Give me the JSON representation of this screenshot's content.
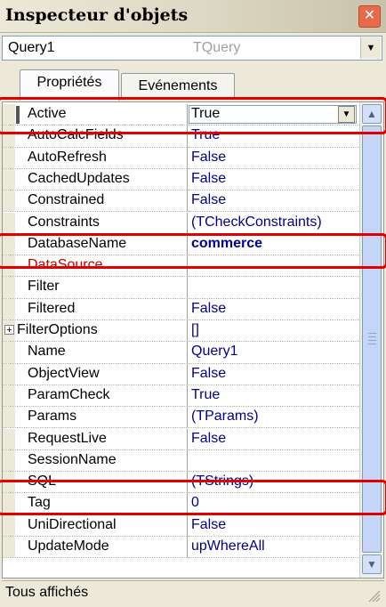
{
  "window": {
    "title": "Inspecteur d'objets"
  },
  "object_selector": {
    "name": "Query1",
    "type": "TQuery"
  },
  "tabs": [
    {
      "label": "Propriétés",
      "active": true
    },
    {
      "label": "Evénements",
      "active": false
    }
  ],
  "properties": [
    {
      "name": "Active",
      "value": "True",
      "selected": true
    },
    {
      "name": "AutoCalcFields",
      "value": "True"
    },
    {
      "name": "AutoRefresh",
      "value": "False"
    },
    {
      "name": "CachedUpdates",
      "value": "False"
    },
    {
      "name": "Constrained",
      "value": "False"
    },
    {
      "name": "Constraints",
      "value": "(TCheckConstraints)"
    },
    {
      "name": "DatabaseName",
      "value": "commerce",
      "bold": true
    },
    {
      "name": "DataSource",
      "value": "",
      "red": true
    },
    {
      "name": "Filter",
      "value": ""
    },
    {
      "name": "Filtered",
      "value": "False"
    },
    {
      "name": "FilterOptions",
      "value": "[]",
      "expandable": true
    },
    {
      "name": "Name",
      "value": "Query1"
    },
    {
      "name": "ObjectView",
      "value": "False"
    },
    {
      "name": "ParamCheck",
      "value": "True"
    },
    {
      "name": "Params",
      "value": "(TParams)"
    },
    {
      "name": "RequestLive",
      "value": "False"
    },
    {
      "name": "SessionName",
      "value": ""
    },
    {
      "name": "SQL",
      "value": "(TStrings)"
    },
    {
      "name": "Tag",
      "value": "0"
    },
    {
      "name": "UniDirectional",
      "value": "False"
    },
    {
      "name": "UpdateMode",
      "value": "upWhereAll"
    }
  ],
  "status": {
    "text": "Tous affichés"
  },
  "colors": {
    "value_text": "#00008b",
    "linked_property": "#c00000",
    "highlight_box": "#e00000",
    "panel": "#ece9d8"
  },
  "icons": {
    "close": "close-icon",
    "dropdown": "chevron-down-icon",
    "scroll_up": "chevron-up-icon",
    "scroll_down": "chevron-down-icon",
    "expand": "plus-box-icon",
    "resize": "resize-grip-icon"
  }
}
